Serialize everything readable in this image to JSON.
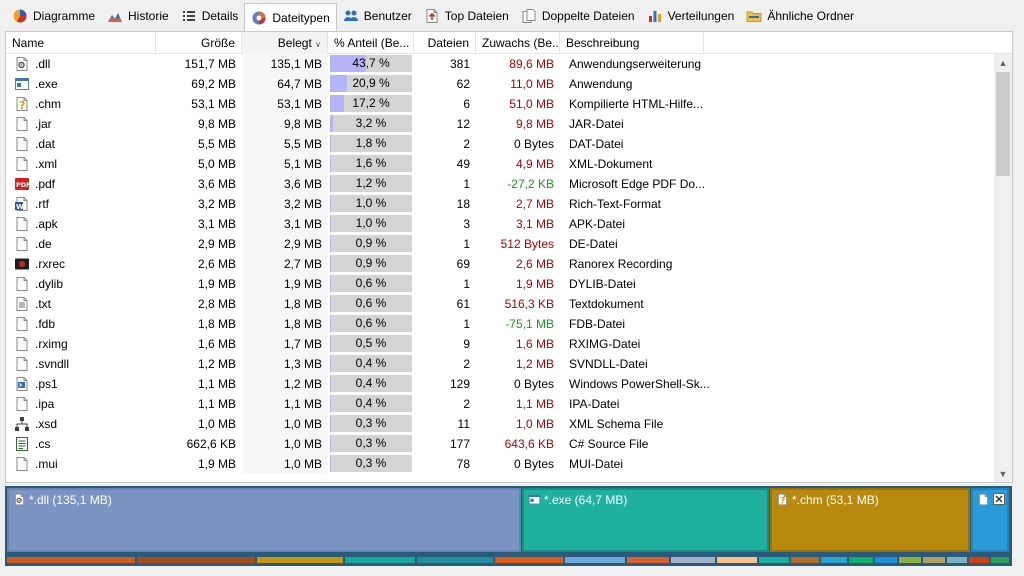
{
  "tabs": [
    {
      "label": "Diagramme",
      "icon": "pie-chart-icon"
    },
    {
      "label": "Historie",
      "icon": "mountain-chart-icon"
    },
    {
      "label": "Details",
      "icon": "list-icon"
    },
    {
      "label": "Dateitypen",
      "icon": "file-types-icon",
      "active": true
    },
    {
      "label": "Benutzer",
      "icon": "users-icon"
    },
    {
      "label": "Top Dateien",
      "icon": "top-files-icon"
    },
    {
      "label": "Doppelte Dateien",
      "icon": "duplicate-files-icon"
    },
    {
      "label": "Verteilungen",
      "icon": "bar-chart-icon"
    },
    {
      "label": "Ähnliche Ordner",
      "icon": "folder-icon"
    }
  ],
  "columns": {
    "name": "Name",
    "size": "Größe",
    "used": "Belegt",
    "pct": "% Anteil (Be...",
    "files": "Dateien",
    "growth": "Zuwachs (Be...",
    "desc": "Beschreibung"
  },
  "rows": [
    {
      "name": ".dll",
      "icon": "dll-icon",
      "size": "151,7 MB",
      "used": "135,1 MB",
      "pct": 43.7,
      "pct_label": "43,7 %",
      "files": "381",
      "growth": "89,6 MB",
      "growth_sign": "pos",
      "desc": "Anwendungserweiterung"
    },
    {
      "name": ".exe",
      "icon": "exe-icon",
      "size": "69,2 MB",
      "used": "64,7 MB",
      "pct": 20.9,
      "pct_label": "20,9 %",
      "files": "62",
      "growth": "11,0 MB",
      "growth_sign": "pos",
      "desc": "Anwendung"
    },
    {
      "name": ".chm",
      "icon": "chm-icon",
      "size": "53,1 MB",
      "used": "53,1 MB",
      "pct": 17.2,
      "pct_label": "17,2 %",
      "files": "6",
      "growth": "51,0 MB",
      "growth_sign": "pos",
      "desc": "Kompilierte HTML-Hilfe..."
    },
    {
      "name": ".jar",
      "icon": "file-icon",
      "size": "9,8 MB",
      "used": "9,8 MB",
      "pct": 3.2,
      "pct_label": "3,2 %",
      "files": "12",
      "growth": "9,8 MB",
      "growth_sign": "pos",
      "desc": "JAR-Datei"
    },
    {
      "name": ".dat",
      "icon": "file-icon",
      "size": "5,5 MB",
      "used": "5,5 MB",
      "pct": 1.8,
      "pct_label": "1,8 %",
      "files": "2",
      "growth": "0 Bytes",
      "growth_sign": "zero",
      "desc": "DAT-Datei"
    },
    {
      "name": ".xml",
      "icon": "file-icon",
      "size": "5,0 MB",
      "used": "5,1 MB",
      "pct": 1.6,
      "pct_label": "1,6 %",
      "files": "49",
      "growth": "4,9 MB",
      "growth_sign": "pos",
      "desc": "XML-Dokument"
    },
    {
      "name": ".pdf",
      "icon": "pdf-icon",
      "size": "3,6 MB",
      "used": "3,6 MB",
      "pct": 1.2,
      "pct_label": "1,2 %",
      "files": "1",
      "growth": "-27,2 KB",
      "growth_sign": "neg",
      "desc": "Microsoft Edge PDF Do..."
    },
    {
      "name": ".rtf",
      "icon": "word-icon",
      "size": "3,2 MB",
      "used": "3,2 MB",
      "pct": 1.0,
      "pct_label": "1,0 %",
      "files": "18",
      "growth": "2,7 MB",
      "growth_sign": "pos",
      "desc": "Rich-Text-Format"
    },
    {
      "name": ".apk",
      "icon": "file-icon",
      "size": "3,1 MB",
      "used": "3,1 MB",
      "pct": 1.0,
      "pct_label": "1,0 %",
      "files": "3",
      "growth": "3,1 MB",
      "growth_sign": "pos",
      "desc": "APK-Datei"
    },
    {
      "name": ".de",
      "icon": "file-icon",
      "size": "2,9 MB",
      "used": "2,9 MB",
      "pct": 0.9,
      "pct_label": "0,9 %",
      "files": "1",
      "growth": "512 Bytes",
      "growth_sign": "pos",
      "desc": "DE-Datei"
    },
    {
      "name": ".rxrec",
      "icon": "recording-icon",
      "size": "2,6 MB",
      "used": "2,7 MB",
      "pct": 0.9,
      "pct_label": "0,9 %",
      "files": "69",
      "growth": "2,6 MB",
      "growth_sign": "pos",
      "desc": "Ranorex Recording"
    },
    {
      "name": ".dylib",
      "icon": "file-icon",
      "size": "1,9 MB",
      "used": "1,9 MB",
      "pct": 0.6,
      "pct_label": "0,6 %",
      "files": "1",
      "growth": "1,9 MB",
      "growth_sign": "pos",
      "desc": "DYLIB-Datei"
    },
    {
      "name": ".txt",
      "icon": "text-file-icon",
      "size": "2,8 MB",
      "used": "1,8 MB",
      "pct": 0.6,
      "pct_label": "0,6 %",
      "files": "61",
      "growth": "516,3 KB",
      "growth_sign": "pos",
      "desc": "Textdokument"
    },
    {
      "name": ".fdb",
      "icon": "file-icon",
      "size": "1,8 MB",
      "used": "1,8 MB",
      "pct": 0.6,
      "pct_label": "0,6 %",
      "files": "1",
      "growth": "-75,1 MB",
      "growth_sign": "neg",
      "desc": "FDB-Datei"
    },
    {
      "name": ".rximg",
      "icon": "file-icon",
      "size": "1,6 MB",
      "used": "1,7 MB",
      "pct": 0.5,
      "pct_label": "0,5 %",
      "files": "9",
      "growth": "1,6 MB",
      "growth_sign": "pos",
      "desc": "RXIMG-Datei"
    },
    {
      "name": ".svndll",
      "icon": "file-icon",
      "size": "1,2 MB",
      "used": "1,3 MB",
      "pct": 0.4,
      "pct_label": "0,4 %",
      "files": "2",
      "growth": "1,2 MB",
      "growth_sign": "pos",
      "desc": "SVNDLL-Datei"
    },
    {
      "name": ".ps1",
      "icon": "powershell-icon",
      "size": "1,1 MB",
      "used": "1,2 MB",
      "pct": 0.4,
      "pct_label": "0,4 %",
      "files": "129",
      "growth": "0 Bytes",
      "growth_sign": "zero",
      "desc": "Windows PowerShell-Sk..."
    },
    {
      "name": ".ipa",
      "icon": "file-icon",
      "size": "1,1 MB",
      "used": "1,1 MB",
      "pct": 0.4,
      "pct_label": "0,4 %",
      "files": "2",
      "growth": "1,1 MB",
      "growth_sign": "pos",
      "desc": "IPA-Datei"
    },
    {
      "name": ".xsd",
      "icon": "schema-icon",
      "size": "1,0 MB",
      "used": "1,0 MB",
      "pct": 0.3,
      "pct_label": "0,3 %",
      "files": "11",
      "growth": "1,0 MB",
      "growth_sign": "pos",
      "desc": "XML Schema File"
    },
    {
      "name": ".cs",
      "icon": "cs-icon",
      "size": "662,6 KB",
      "used": "1,0 MB",
      "pct": 0.3,
      "pct_label": "0,3 %",
      "files": "177",
      "growth": "643,6 KB",
      "growth_sign": "pos",
      "desc": "C# Source File"
    },
    {
      "name": ".mui",
      "icon": "file-icon",
      "size": "1,9 MB",
      "used": "1,0 MB",
      "pct": 0.3,
      "pct_label": "0,3 %",
      "files": "78",
      "growth": "0 Bytes",
      "growth_sign": "zero",
      "desc": "MUI-Datei"
    }
  ],
  "treemap": {
    "blocks": [
      {
        "label": "*.dll (135,1 MB)",
        "icon": "dll-icon",
        "bg": "#7b94c2",
        "border": "#6a83b5"
      },
      {
        "label": "*.exe (64,7 MB)",
        "icon": "exe-icon",
        "bg": "#1fb0a0",
        "border": "#178e82"
      },
      {
        "label": "*.chm (53,1 MB)",
        "icon": "chm-icon",
        "bg": "#b9890f",
        "border": "#9a700a"
      },
      {
        "label": "",
        "icon": "file-icon",
        "bg": "#2a9ad8",
        "border": "#2184bb"
      }
    ],
    "strip_colors": [
      "#d05a1a",
      "#a84b18",
      "#c79310",
      "#17a89b",
      "#1f8fa0",
      "#e05a18",
      "#6fa7d8",
      "#d95f2f",
      "#9fb0c8",
      "#f6c089",
      "#19b0a0",
      "#b36b2a",
      "#2aa5d0",
      "#0fb06a",
      "#2090d8",
      "#8fb040",
      "#b0a060",
      "#7fb0c0",
      "#d04010",
      "#30a060"
    ]
  }
}
